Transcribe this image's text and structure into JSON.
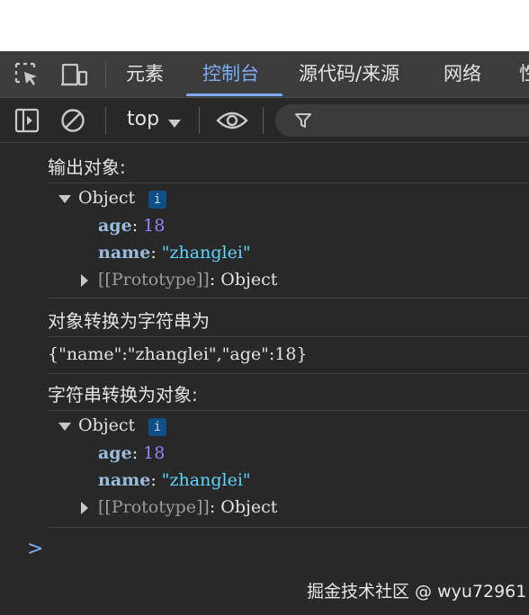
{
  "tabs": {
    "elements": "元素",
    "console": "控制台",
    "sources": "源代码/来源",
    "network": "网络",
    "performance": "性"
  },
  "toolbar": {
    "context": "top"
  },
  "console": {
    "log1_label": "输出对象:",
    "obj1": {
      "type": "Object",
      "info": "i",
      "age_key": "age",
      "age_value": "18",
      "name_key": "name",
      "name_value": "\"zhanglei\"",
      "proto_key": "[[Prototype]]",
      "proto_value": "Object"
    },
    "log2_label": "对象转换为字符串为",
    "json_text": "{\"name\":\"zhanglei\",\"age\":18}",
    "log3_label": "字符串转换为对象:",
    "obj2": {
      "type": "Object",
      "info": "i",
      "age_key": "age",
      "age_value": "18",
      "name_key": "name",
      "name_value": "\"zhanglei\"",
      "proto_key": "[[Prototype]]",
      "proto_value": "Object"
    },
    "prompt": ">"
  },
  "watermark": "掘金技术社区 @ wyu72961",
  "colors": {
    "background": "#282828",
    "accent": "#7cacf8",
    "string": "#5cd5fb",
    "number": "#9980ff"
  },
  "icons": [
    "inspect-icon",
    "device-toggle-icon",
    "sidebar-toggle-icon",
    "clear-console-icon",
    "dropdown-caret-icon",
    "eye-icon",
    "filter-icon"
  ]
}
